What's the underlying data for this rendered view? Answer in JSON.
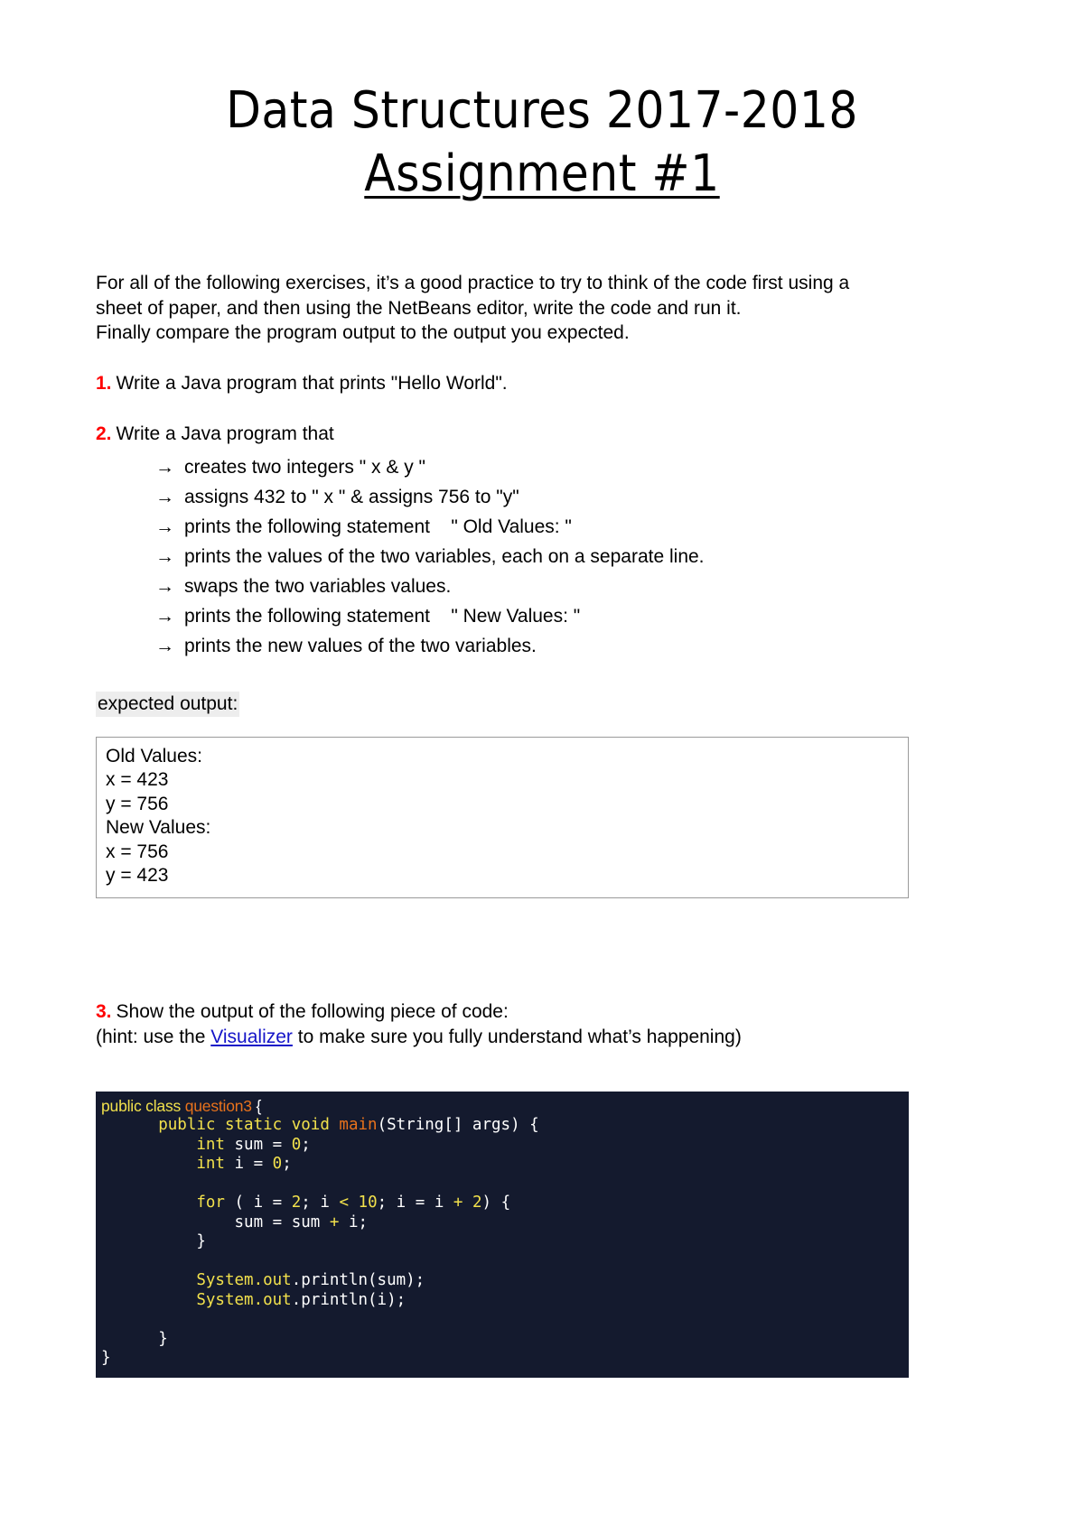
{
  "document": {
    "title_line1": "Data Structures 2017-2018",
    "title_line2": "Assignment #1"
  },
  "intro": {
    "line1": "For all of the following exercises, it’s a good practice to try to think of the code first using a",
    "line2": "sheet of paper, and then using the NetBeans editor, write the code and run it.",
    "line3": "Finally compare the program output to the output you expected."
  },
  "questions": {
    "q1": {
      "number": "1.",
      "text": "Write a Java program that prints \"Hello World\"."
    },
    "q2": {
      "number": "2.",
      "text": "Write a Java program that",
      "arrow": "→",
      "bullets": [
        "creates two integers \" x & y \"",
        "assigns 432 to \" x \" & assigns 756 to \"y\"",
        "prints the following statement    \" Old Values: \"",
        "prints the values of the two variables, each on a separate line.",
        "swaps the two variables values.",
        "prints the following statement    \" New Values: \"",
        "prints the new values of the two variables."
      ]
    },
    "q3": {
      "number": "3.",
      "text": "Show the output of the following piece of code:",
      "hint_before": "(hint: use the ",
      "hint_link": "Visualizer",
      "hint_after": " to make sure you fully understand what’s happening)"
    }
  },
  "expected_output": {
    "label": "expected output:",
    "lines": [
      "Old Values:",
      "x = 423",
      "y = 756",
      "New Values:",
      "x = 756",
      "y = 423"
    ]
  },
  "code_block": {
    "background": "#141a2e",
    "keyword_color": "#f2e14c",
    "class_color": "#e8721c",
    "plain_color": "#ffffff",
    "lines": {
      "l1_kw": "public class ",
      "l1_cls": "question3",
      "l1_pln": " {",
      "l2_kw": "public static void ",
      "l2_cls": "main",
      "l2_pln": "(String[] args) {",
      "l3_kw": "int",
      "l3_pln_a": " sum = ",
      "l3_num": "0",
      "l3_pln_b": ";",
      "l4_kw": "int",
      "l4_pln_a": " i = ",
      "l4_num": "0",
      "l4_pln_b": ";",
      "l6_kw": "for",
      "l6_pln_a": " ( i = ",
      "l6_num_a": "2",
      "l6_pln_b": "; i ",
      "l6_op_a": "<",
      "l6_pln_c": " ",
      "l6_num_b": "10",
      "l6_pln_d": "; i = i ",
      "l6_op_b": "+",
      "l6_pln_e": " ",
      "l6_num_c": "2",
      "l6_pln_f": ") {",
      "l7_pln_a": "sum = sum ",
      "l7_op": "+",
      "l7_pln_b": " i;",
      "l8_pln": "}",
      "l10_kw": "System.out",
      "l10_pln": ".println(sum);",
      "l11_kw": "System.out",
      "l11_pln": ".println(i);",
      "l13_pln": "}",
      "l14_pln": "}"
    }
  }
}
